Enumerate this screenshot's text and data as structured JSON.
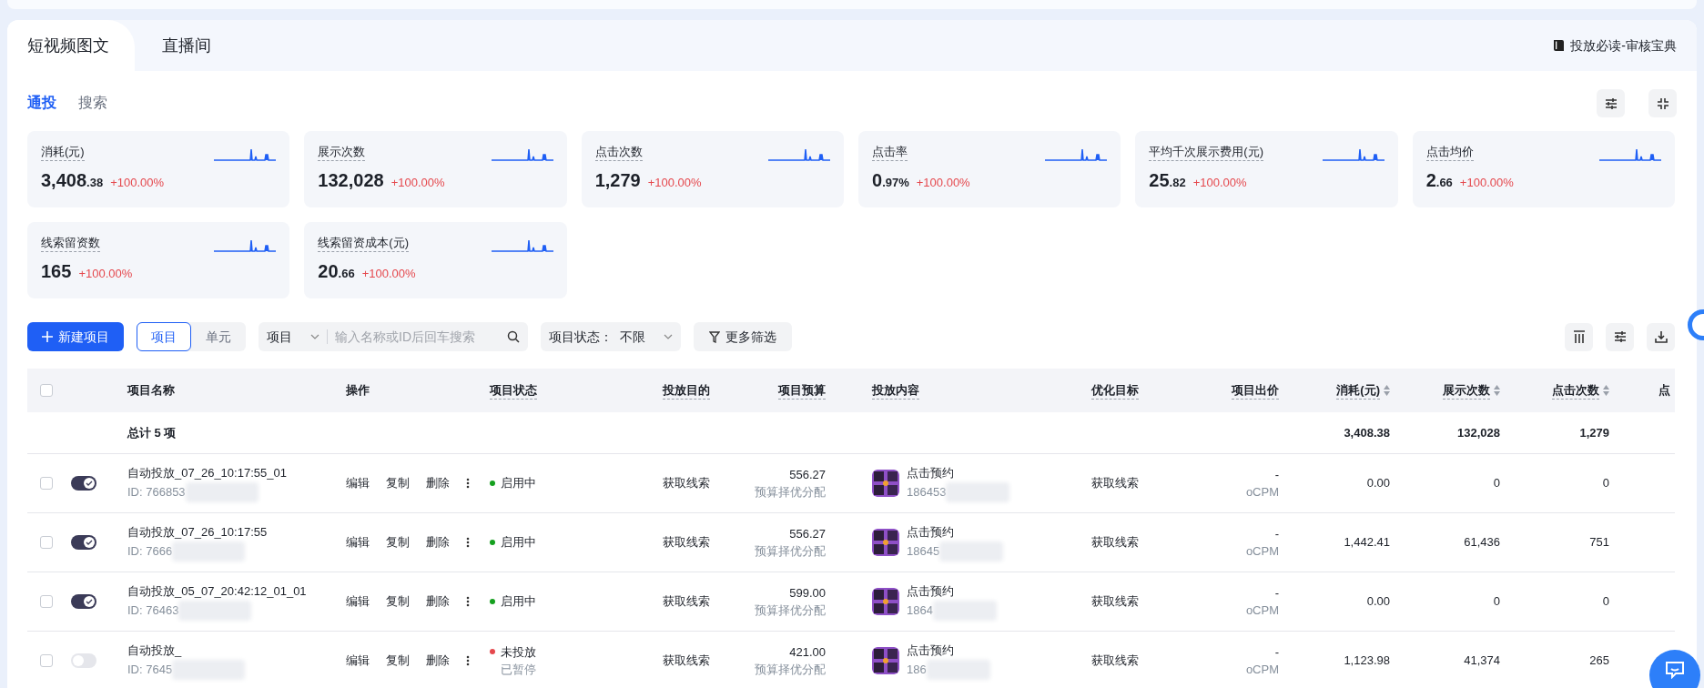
{
  "top_tabs": [
    {
      "label": "短视频图文",
      "selected": true
    },
    {
      "label": "直播间",
      "selected": false
    }
  ],
  "guide_link": "投放必读-审核宝典",
  "sub_tabs": [
    {
      "label": "通投",
      "selected": true
    },
    {
      "label": "搜索",
      "selected": false
    }
  ],
  "metrics": [
    {
      "title": "消耗(元)",
      "value": "3,408",
      "decimals": ".38",
      "change": "+100.00%"
    },
    {
      "title": "展示次数",
      "value": "132,028",
      "change": "+100.00%"
    },
    {
      "title": "点击次数",
      "value": "1,279",
      "change": "+100.00%"
    },
    {
      "title": "点击率",
      "value": "0",
      "decimals": ".97%",
      "change": "+100.00%"
    },
    {
      "title": "平均千次展示费用(元)",
      "value": "25",
      "decimals": ".82",
      "change": "+100.00%"
    },
    {
      "title": "点击均价",
      "value": "2",
      "decimals": ".66",
      "change": "+100.00%"
    },
    {
      "title": "线索留资数",
      "value": "165",
      "change": "+100.00%"
    },
    {
      "title": "线索留资成本(元)",
      "value": "20",
      "decimals": ".66",
      "change": "+100.00%"
    }
  ],
  "toolbar": {
    "new_button": "新建项目",
    "view_toggle": [
      {
        "label": "项目",
        "selected": true
      },
      {
        "label": "单元",
        "selected": false
      }
    ],
    "search": {
      "scope": "项目",
      "placeholder": "输入名称或ID后回车搜索"
    },
    "status_filter": {
      "label": "项目状态：",
      "value": "不限"
    },
    "more_filter": "更多筛选"
  },
  "table": {
    "columns": [
      {
        "label": "项目名称",
        "hint": false,
        "sortable": false
      },
      {
        "label": "操作",
        "hint": false,
        "sortable": false
      },
      {
        "label": "项目状态",
        "hint": true,
        "sortable": false
      },
      {
        "label": "投放目的",
        "hint": true,
        "sortable": false
      },
      {
        "label": "项目预算",
        "hint": true,
        "sortable": false
      },
      {
        "label": "投放内容",
        "hint": true,
        "sortable": false
      },
      {
        "label": "优化目标",
        "hint": true,
        "sortable": false
      },
      {
        "label": "项目出价",
        "hint": true,
        "sortable": false
      },
      {
        "label": "消耗(元)",
        "hint": true,
        "sortable": true
      },
      {
        "label": "展示次数",
        "hint": true,
        "sortable": true
      },
      {
        "label": "点击次数",
        "hint": true,
        "sortable": true
      },
      {
        "label": "点",
        "hint": false,
        "sortable": false
      }
    ],
    "header_checked": false,
    "summary": {
      "label": "总计 5 项",
      "spend": "3,408.38",
      "impressions": "132,028",
      "clicks": "1,279"
    },
    "rows": [
      {
        "checked": false,
        "on": true,
        "name": "自动投放_07_26_10:17:55_01",
        "id": "ID: 766853",
        "actions": [
          "编辑",
          "复制",
          "删除"
        ],
        "status": "启用中",
        "color": "#14a01e",
        "purpose": "获取线索",
        "budget": "556.27",
        "budget_mode": "预算择优分配",
        "content_title": "点击预约",
        "content_id": "186453",
        "target": "获取线索",
        "bid": "-",
        "bid_type": "oCPM",
        "spend": "0.00",
        "impressions": "0",
        "clicks": "0"
      },
      {
        "checked": false,
        "on": true,
        "name": "自动投放_07_26_10:17:55",
        "id": "ID: 7666",
        "actions": [
          "编辑",
          "复制",
          "删除"
        ],
        "status": "启用中",
        "color": "#14a01e",
        "purpose": "获取线索",
        "budget": "556.27",
        "budget_mode": "预算择优分配",
        "content_title": "点击预约",
        "content_id": "18645",
        "target": "获取线索",
        "bid": "-",
        "bid_type": "oCPM",
        "spend": "1,442.41",
        "impressions": "61,436",
        "clicks": "751"
      },
      {
        "checked": false,
        "on": true,
        "name": "自动投放_05_07_20:42:12_01_01",
        "id": "ID: 76463",
        "actions": [
          "编辑",
          "复制",
          "删除"
        ],
        "status": "启用中",
        "color": "#14a01e",
        "purpose": "获取线索",
        "budget": "599.00",
        "budget_mode": "预算择优分配",
        "content_title": "点击预约",
        "content_id": "1864",
        "target": "获取线索",
        "bid": "-",
        "bid_type": "oCPM",
        "spend": "0.00",
        "impressions": "0",
        "clicks": "0"
      },
      {
        "checked": false,
        "on": false,
        "name": "自动投放_",
        "id": "ID: 7645",
        "actions": [
          "编辑",
          "复制",
          "删除"
        ],
        "status": "未投放",
        "status_note": "已暂停",
        "color": "#e5484d",
        "purpose": "获取线索",
        "budget": "421.00",
        "budget_mode": "预算择优分配",
        "content_title": "点击预约",
        "content_id": "186",
        "target": "获取线索",
        "bid": "-",
        "bid_type": "oCPM",
        "spend": "1,123.98",
        "impressions": "41,374",
        "clicks": "265"
      }
    ]
  }
}
